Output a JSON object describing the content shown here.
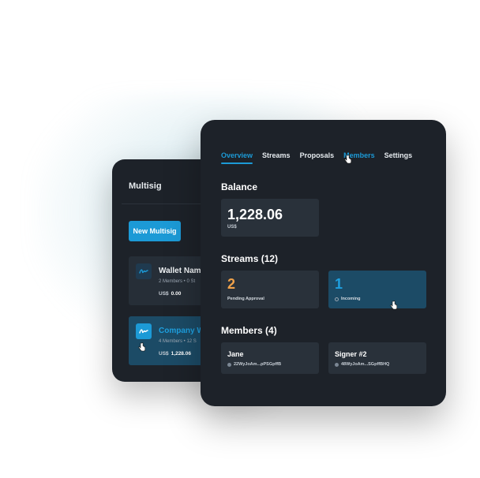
{
  "colors": {
    "accent": "#1c9ad6",
    "pending": "#f0a24a",
    "card_bg": "#1d2229",
    "panel_bg": "#29313a",
    "highlight_bg": "#1c4b66"
  },
  "back_panel": {
    "title": "Multisig",
    "new_button": "New Multisig",
    "wallets": [
      {
        "name": "Wallet Nam",
        "meta": "2 Members • 0 St",
        "currency": "US$",
        "balance": "0.00",
        "icon": "wallet-signature-icon"
      },
      {
        "name": "Company W",
        "meta": "4 Members • 12 S",
        "currency": "US$",
        "balance": "1,228.06",
        "icon": "wallet-signature-icon"
      }
    ]
  },
  "front_panel": {
    "tabs": [
      {
        "label": "Overview",
        "state": "active"
      },
      {
        "label": "Streams",
        "state": "normal"
      },
      {
        "label": "Proposals",
        "state": "normal"
      },
      {
        "label": "Members",
        "state": "hover"
      },
      {
        "label": "Settings",
        "state": "normal"
      }
    ],
    "balance": {
      "title": "Balance",
      "value": "1,228.06",
      "currency": "US$"
    },
    "streams": {
      "title": "Streams (12)",
      "pending": {
        "count": "2",
        "label": "Pending Approval"
      },
      "incoming": {
        "count": "1",
        "label": "Incoming",
        "icon": "clock-icon"
      }
    },
    "members": {
      "title": "Members (4)",
      "items": [
        {
          "name": "Jane",
          "address": "22WyJoAm...pPSGpffB",
          "icon": "avatar-dot-icon"
        },
        {
          "name": "Signer #2",
          "address": "48WyJoAm...SGpffBHQ",
          "icon": "avatar-dot-icon"
        }
      ]
    }
  }
}
